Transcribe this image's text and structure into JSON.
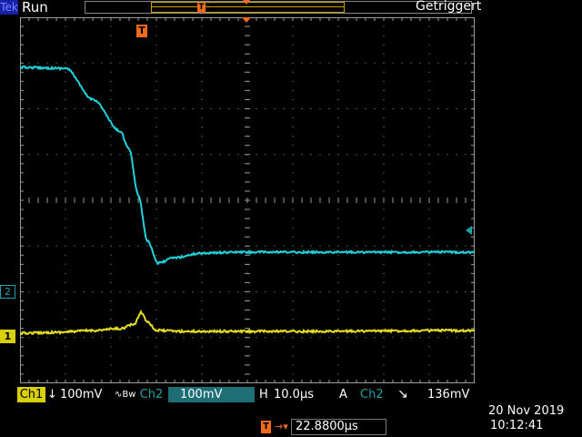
{
  "top_bar": {
    "brand": "Tek",
    "acquisition_state": "Run",
    "trigger_state": "Getriggert",
    "trigger_marker": "T"
  },
  "channels": {
    "ch1": {
      "marker": "1",
      "label": "Ch1",
      "coupling_symbol": "↓",
      "scale": "100mV",
      "bw_symbol": "∿Bw",
      "color": "#d8d000"
    },
    "ch2": {
      "marker": "2",
      "label": "Ch2",
      "scale": "100mV",
      "color": "#1fa3a8"
    }
  },
  "horizontal": {
    "label": "H",
    "scale": "10.0µs"
  },
  "trigger": {
    "mode_label": "A",
    "source": "Ch2",
    "slope_symbol": "↘",
    "level": "136mV",
    "delay_icon": "T",
    "delay_arrow": "→▾",
    "delay": "22.8800µs"
  },
  "datetime": {
    "date": "20 Nov 2019",
    "time": "10:12:41"
  },
  "colors": {
    "accent_orange": "#f26a1b",
    "ch1_yellow": "#d8d000",
    "ch2_cyan": "#1fa3a8",
    "grid": "#9a9a9a"
  }
}
